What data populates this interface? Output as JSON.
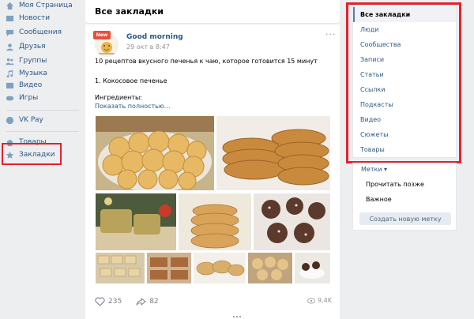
{
  "sidebar": {
    "items": [
      {
        "label": "Моя Страница",
        "icon": "home-icon"
      },
      {
        "label": "Новости",
        "icon": "news-icon"
      },
      {
        "label": "Сообщения",
        "icon": "messages-icon"
      },
      {
        "label": "Друзья",
        "icon": "friends-icon"
      },
      {
        "label": "Группы",
        "icon": "groups-icon"
      },
      {
        "label": "Музыка",
        "icon": "music-icon"
      },
      {
        "label": "Видео",
        "icon": "video-icon"
      },
      {
        "label": "Игры",
        "icon": "games-icon"
      },
      {
        "label": "VK Pay",
        "icon": "vkpay-icon"
      },
      {
        "label": "Товары",
        "icon": "market-icon"
      },
      {
        "label": "Закладки",
        "icon": "star-icon"
      }
    ]
  },
  "main": {
    "title": "Все закладки"
  },
  "post": {
    "badge": "New",
    "author": "Good morning",
    "date": "29 окт в 8:47",
    "line1": "10 рецептов вкусного печенья к чаю, которое готовится 15 минут",
    "line2": "1. Кокосовое печенье",
    "line3": "Ингредиенты:",
    "show_more": "Показать полностью…",
    "likes": "235",
    "shares": "82",
    "views": "9,4K"
  },
  "filters": {
    "items": [
      "Все закладки",
      "Люди",
      "Сообщества",
      "Записи",
      "Статьи",
      "Ссылки",
      "Подкасты",
      "Видео",
      "Сюжеты",
      "Товары"
    ],
    "active": 0
  },
  "labels": {
    "title": "Метки ▾",
    "items": [
      "Прочитать позже",
      "Важное"
    ],
    "button": "Создать новую метку"
  },
  "colors": {
    "link": "#2a5885",
    "highlight": "#e5202e",
    "background": "#edeef0"
  }
}
